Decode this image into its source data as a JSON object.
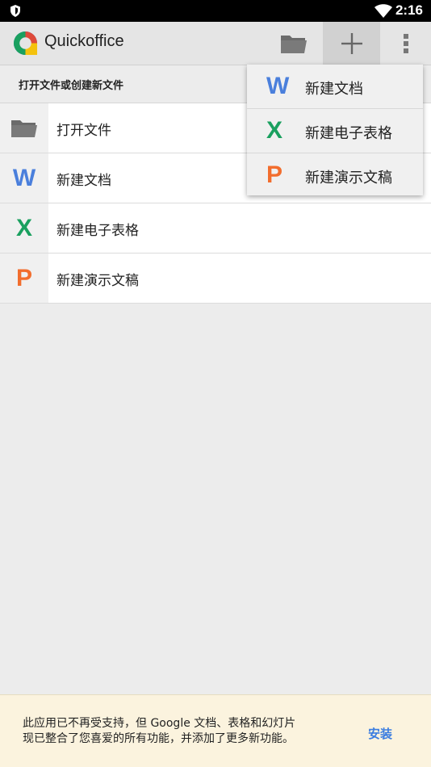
{
  "status_bar": {
    "time": "2:16",
    "icons": [
      "shield-icon",
      "wifi-icon"
    ]
  },
  "app_bar": {
    "title": "Quickoffice",
    "actions": [
      "folder-icon",
      "add-icon",
      "more-vert-icon"
    ]
  },
  "section": {
    "header": "打开文件或创建新文件"
  },
  "list": {
    "items": [
      {
        "icon": "folder-icon",
        "label": "打开文件"
      },
      {
        "icon": "W",
        "label": "新建文档"
      },
      {
        "icon": "X",
        "label": "新建电子表格"
      },
      {
        "icon": "P",
        "label": "新建演示文稿"
      }
    ]
  },
  "menu": {
    "items": [
      {
        "icon": "W",
        "label": "新建文档"
      },
      {
        "icon": "X",
        "label": "新建电子表格"
      },
      {
        "icon": "P",
        "label": "新建演示文稿"
      }
    ]
  },
  "banner": {
    "message_line1": "此应用已不再受支持，但 Google 文档、表格和幻灯片",
    "message_line2": "现已整合了您喜爱的所有功能，并添加了更多新功能。",
    "action": "安装"
  },
  "colors": {
    "doc": "#4a7fdc",
    "sheet": "#1aa05f",
    "slides": "#f26d2d",
    "link": "#3b7de0"
  }
}
